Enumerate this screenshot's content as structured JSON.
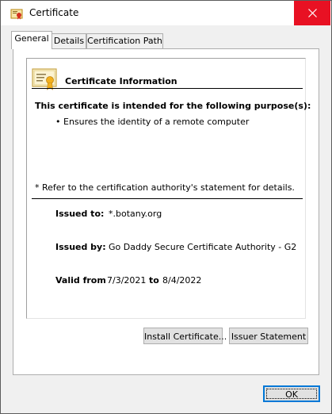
{
  "window": {
    "title": "Certificate",
    "icon": "certificate-icon",
    "close_icon": "close-icon",
    "close_color": "#e81123"
  },
  "tabs": [
    {
      "label": "General",
      "active": true
    },
    {
      "label": "Details",
      "active": false
    },
    {
      "label": "Certification Path",
      "active": false
    }
  ],
  "general": {
    "info_title": "Certificate Information",
    "purpose_heading": "This certificate is intended for the following purpose(s):",
    "purposes": [
      "Ensures the identity of a remote computer"
    ],
    "note": "* Refer to the certification authority's statement for details.",
    "issued_to_label": "Issued to:",
    "issued_to_value": "*.botany.org",
    "issued_by_label": "Issued by:",
    "issued_by_value": "Go Daddy Secure Certificate Authority - G2",
    "valid_from_label": "Valid from",
    "valid_from_value": "7/3/2021",
    "valid_to_label": "to",
    "valid_to_value": "8/4/2022",
    "install_button": "Install Certificate...",
    "issuer_button": "Issuer Statement"
  },
  "footer": {
    "ok_button": "OK"
  }
}
